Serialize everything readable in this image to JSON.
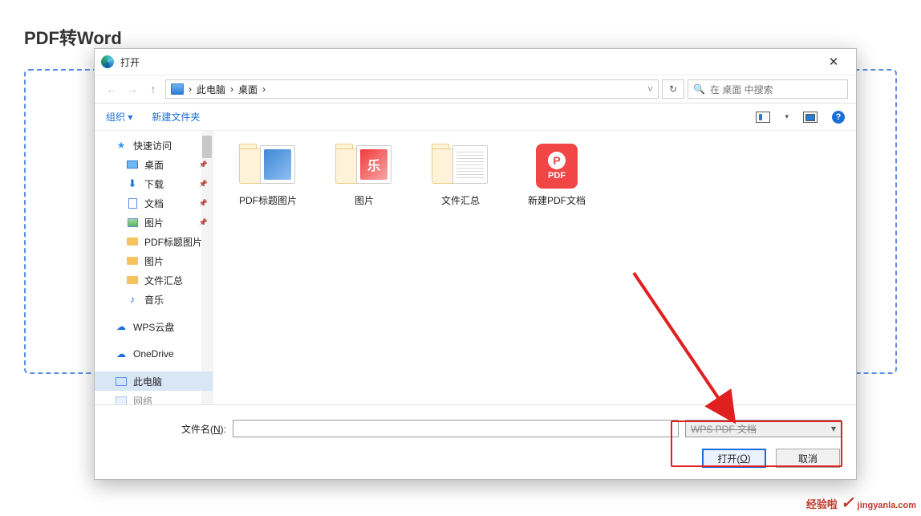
{
  "page": {
    "title": "PDF转Word"
  },
  "dialog": {
    "title": "打开",
    "nav": {
      "breadcrumb_root": "此电脑",
      "breadcrumb_sep": "›",
      "breadcrumb_loc": "桌面",
      "search_placeholder": "在 桌面 中搜索"
    },
    "toolbar": {
      "organize": "组织",
      "new_folder": "新建文件夹"
    },
    "sidebar": {
      "items": [
        {
          "icon": "star",
          "label": "快速访问",
          "pin": false,
          "indent": false
        },
        {
          "icon": "desktop",
          "label": "桌面",
          "pin": true,
          "indent": true
        },
        {
          "icon": "download",
          "label": "下载",
          "pin": true,
          "indent": true
        },
        {
          "icon": "doc",
          "label": "文档",
          "pin": true,
          "indent": true
        },
        {
          "icon": "image",
          "label": "图片",
          "pin": true,
          "indent": true
        },
        {
          "icon": "folder",
          "label": "PDF标题图片",
          "pin": false,
          "indent": true
        },
        {
          "icon": "folder",
          "label": "图片",
          "pin": false,
          "indent": true
        },
        {
          "icon": "folder",
          "label": "文件汇总",
          "pin": false,
          "indent": true
        },
        {
          "icon": "music",
          "label": "音乐",
          "pin": false,
          "indent": true
        },
        {
          "icon": "cloud",
          "label": "WPS云盘",
          "pin": false,
          "indent": false
        },
        {
          "icon": "cloud",
          "label": "OneDrive",
          "pin": false,
          "indent": false
        },
        {
          "icon": "pc",
          "label": "此电脑",
          "pin": false,
          "indent": false,
          "selected": true
        },
        {
          "icon": "net",
          "label": "网络",
          "pin": false,
          "indent": false
        }
      ]
    },
    "files": [
      {
        "type": "folder-blue",
        "label": "PDF标题图片"
      },
      {
        "type": "folder-red",
        "label": "图片"
      },
      {
        "type": "folder-docs",
        "label": "文件汇总"
      },
      {
        "type": "pdf",
        "label": "新建PDF文档"
      }
    ],
    "footer": {
      "filename_label_pre": "文件名(",
      "filename_label_u": "N",
      "filename_label_post": "):",
      "filename_value": "",
      "filetype_value": "WPS PDF 文档",
      "open_pre": "打开(",
      "open_u": "O",
      "open_post": ")",
      "cancel_label": "取消"
    }
  },
  "watermark": {
    "cn": "经验啦",
    "dom": "jingyanla.com"
  }
}
